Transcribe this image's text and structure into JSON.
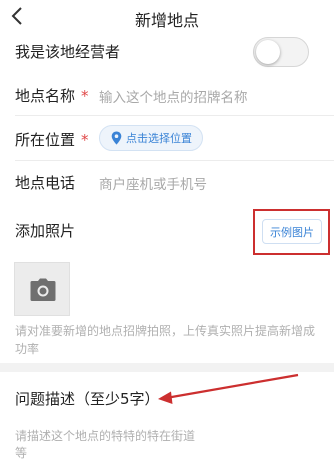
{
  "nav": {
    "title": "新增地点"
  },
  "operator_row": {
    "label": "我是该地经营者",
    "toggle_on": false
  },
  "name_row": {
    "label": "地点名称",
    "required_mark": "*",
    "placeholder": "输入这个地点的招牌名称"
  },
  "location_row": {
    "label": "所在位置",
    "required_mark": "*",
    "button_label": "点击选择位置"
  },
  "phone_row": {
    "label": "地点电话",
    "placeholder": "商户座机或手机号"
  },
  "photos": {
    "label": "添加照片",
    "example_button": "示例图片",
    "hint": "请对准要新增的地点招牌拍照，上传真实照片提高新增成功率"
  },
  "issue": {
    "label": "问题描述（至少5字）",
    "placeholder": "请描述这个地点的特特的特在街道等"
  },
  "colors": {
    "accent": "#3a83d6",
    "required": "#e04848",
    "annotation": "#cc2f2f"
  },
  "icons": {
    "back": "chevron-left",
    "pin": "location-pin",
    "camera": "camera"
  }
}
